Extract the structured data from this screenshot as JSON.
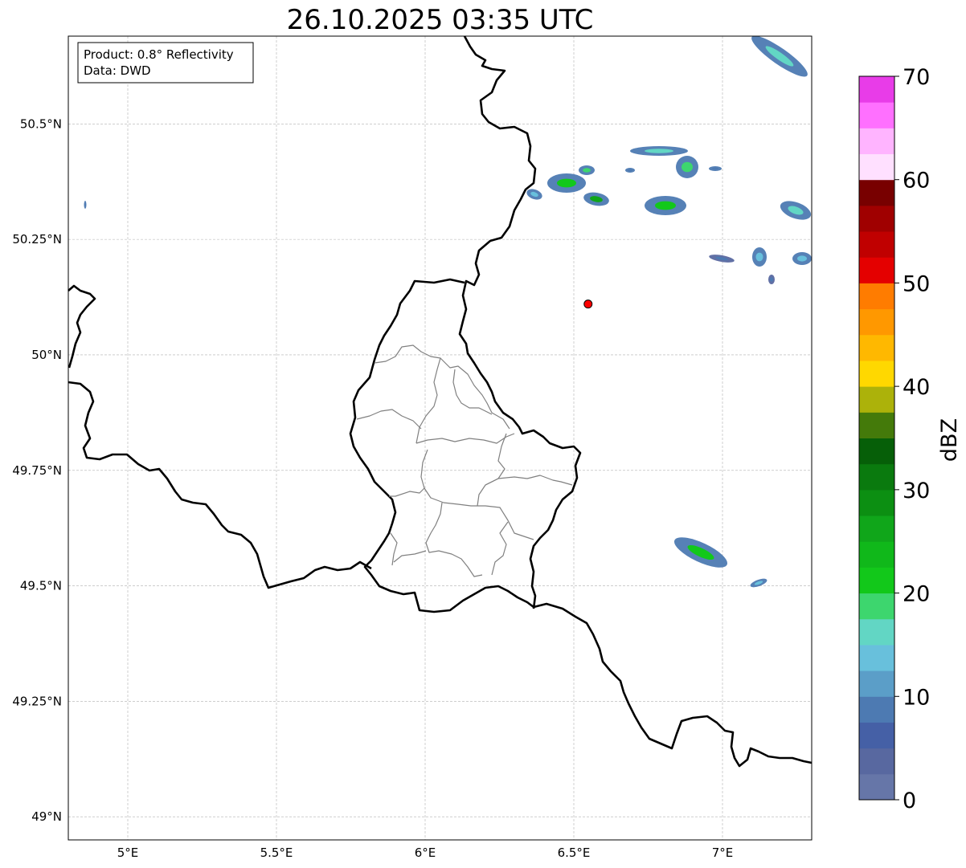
{
  "title": "26.10.2025 03:35 UTC",
  "info_box": {
    "product": "Product: 0.8° Reflectivity",
    "source": "Data: DWD"
  },
  "map": {
    "lon_range": [
      4.8,
      7.3
    ],
    "lat_range": [
      48.95,
      50.69
    ],
    "lon_ticks": [
      {
        "value": 5.0,
        "label": "5°E"
      },
      {
        "value": 5.5,
        "label": "5.5°E"
      },
      {
        "value": 6.0,
        "label": "6°E"
      },
      {
        "value": 6.5,
        "label": "6.5°E"
      },
      {
        "value": 7.0,
        "label": "7°E"
      }
    ],
    "lat_ticks": [
      {
        "value": 49.0,
        "label": "49°N"
      },
      {
        "value": 49.25,
        "label": "49.25°N"
      },
      {
        "value": 49.5,
        "label": "49.5°N"
      },
      {
        "value": 49.75,
        "label": "49.75°N"
      },
      {
        "value": 50.0,
        "label": "50°N"
      },
      {
        "value": 50.25,
        "label": "50.25°N"
      },
      {
        "value": 50.5,
        "label": "50.5°N"
      }
    ],
    "gridlines": true,
    "radar_site": {
      "lon": 6.548,
      "lat": 50.11,
      "color": "#ff0000"
    },
    "border_color": "#000000",
    "admin_border_color": "#808080"
  },
  "colorbar": {
    "label": "dBZ",
    "min": 0,
    "max": 70,
    "ticks": [
      {
        "value": 0,
        "label": "0"
      },
      {
        "value": 10,
        "label": "10"
      },
      {
        "value": 20,
        "label": "20"
      },
      {
        "value": 30,
        "label": "30"
      },
      {
        "value": 40,
        "label": "40"
      },
      {
        "value": 50,
        "label": "50"
      },
      {
        "value": 60,
        "label": "60"
      },
      {
        "value": 70,
        "label": "70"
      }
    ],
    "colors": [
      "#6676a8",
      "#5868a0",
      "#4560a6",
      "#4d7ab2",
      "#5b9ec8",
      "#68c0dc",
      "#62d6c4",
      "#3dd66e",
      "#12c81a",
      "#10b81a",
      "#10a61a",
      "#0c8f12",
      "#0a7a0e",
      "#065f08",
      "#447a0a",
      "#acb20a",
      "#ffd800",
      "#ffb800",
      "#ff9800",
      "#ff7c00",
      "#e40000",
      "#c00000",
      "#a00000",
      "#780000",
      "#ffe0ff",
      "#ffb4ff",
      "#ff70ff",
      "#e83ce8"
    ]
  }
}
